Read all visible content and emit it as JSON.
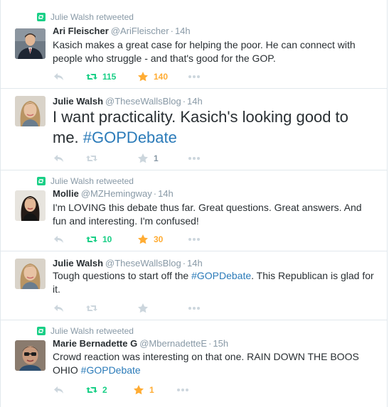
{
  "tweets": [
    {
      "retweeted_by": "Julie Walsh retweeted",
      "name": "Ari Fleischer",
      "handle": "@AriFleischer",
      "time": "14h",
      "text": "Kasich makes a great case for helping the poor. He can connect with people who struggle - and that's good for the GOP.",
      "retweets": "115",
      "favorites": "140",
      "rt_active": true,
      "fav_active": true
    },
    {
      "retweeted_by": "",
      "name": "Julie Walsh",
      "handle": "@TheseWallsBlog",
      "time": "14h",
      "text_pre": "I want practicality. Kasich's looking good to me. ",
      "hashtag": "#GOPDebate",
      "text_post": "",
      "retweets": "",
      "favorites": "1",
      "rt_active": false,
      "fav_active": false
    },
    {
      "retweeted_by": "Julie Walsh retweeted",
      "name": "Mollie",
      "handle": "@MZHemingway",
      "time": "14h",
      "text": "I'm LOVING this debate thus far. Great questions. Great answers. And fun and interesting. I'm confused!",
      "retweets": "10",
      "favorites": "30",
      "rt_active": true,
      "fav_active": true
    },
    {
      "retweeted_by": "",
      "name": "Julie Walsh",
      "handle": "@TheseWallsBlog",
      "time": "14h",
      "text_pre": "Tough questions to start off the ",
      "hashtag": "#GOPDebate",
      "text_post": ". This Republican is glad for it.",
      "retweets": "",
      "favorites": "",
      "rt_active": false,
      "fav_active": false
    },
    {
      "retweeted_by": "Julie Walsh retweeted",
      "name": "Marie Bernadette G",
      "handle": "@MbernadetteE",
      "time": "15h",
      "text_pre": "Crowd reaction was interesting on that one. RAIN DOWN THE BOOS OHIO ",
      "hashtag": "#GOPDebate",
      "text_post": "",
      "retweets": "2",
      "favorites": "1",
      "rt_active": true,
      "fav_active": true
    }
  ],
  "icons": {
    "reply": "reply-icon",
    "retweet": "retweet-icon",
    "favorite": "star-icon",
    "more": "more-icon"
  },
  "colors": {
    "retweet_active": "#19cf86",
    "favorite_active": "#ffac33",
    "muted": "#8899a6",
    "hashtag": "#2b7bb9",
    "text": "#292f33"
  }
}
